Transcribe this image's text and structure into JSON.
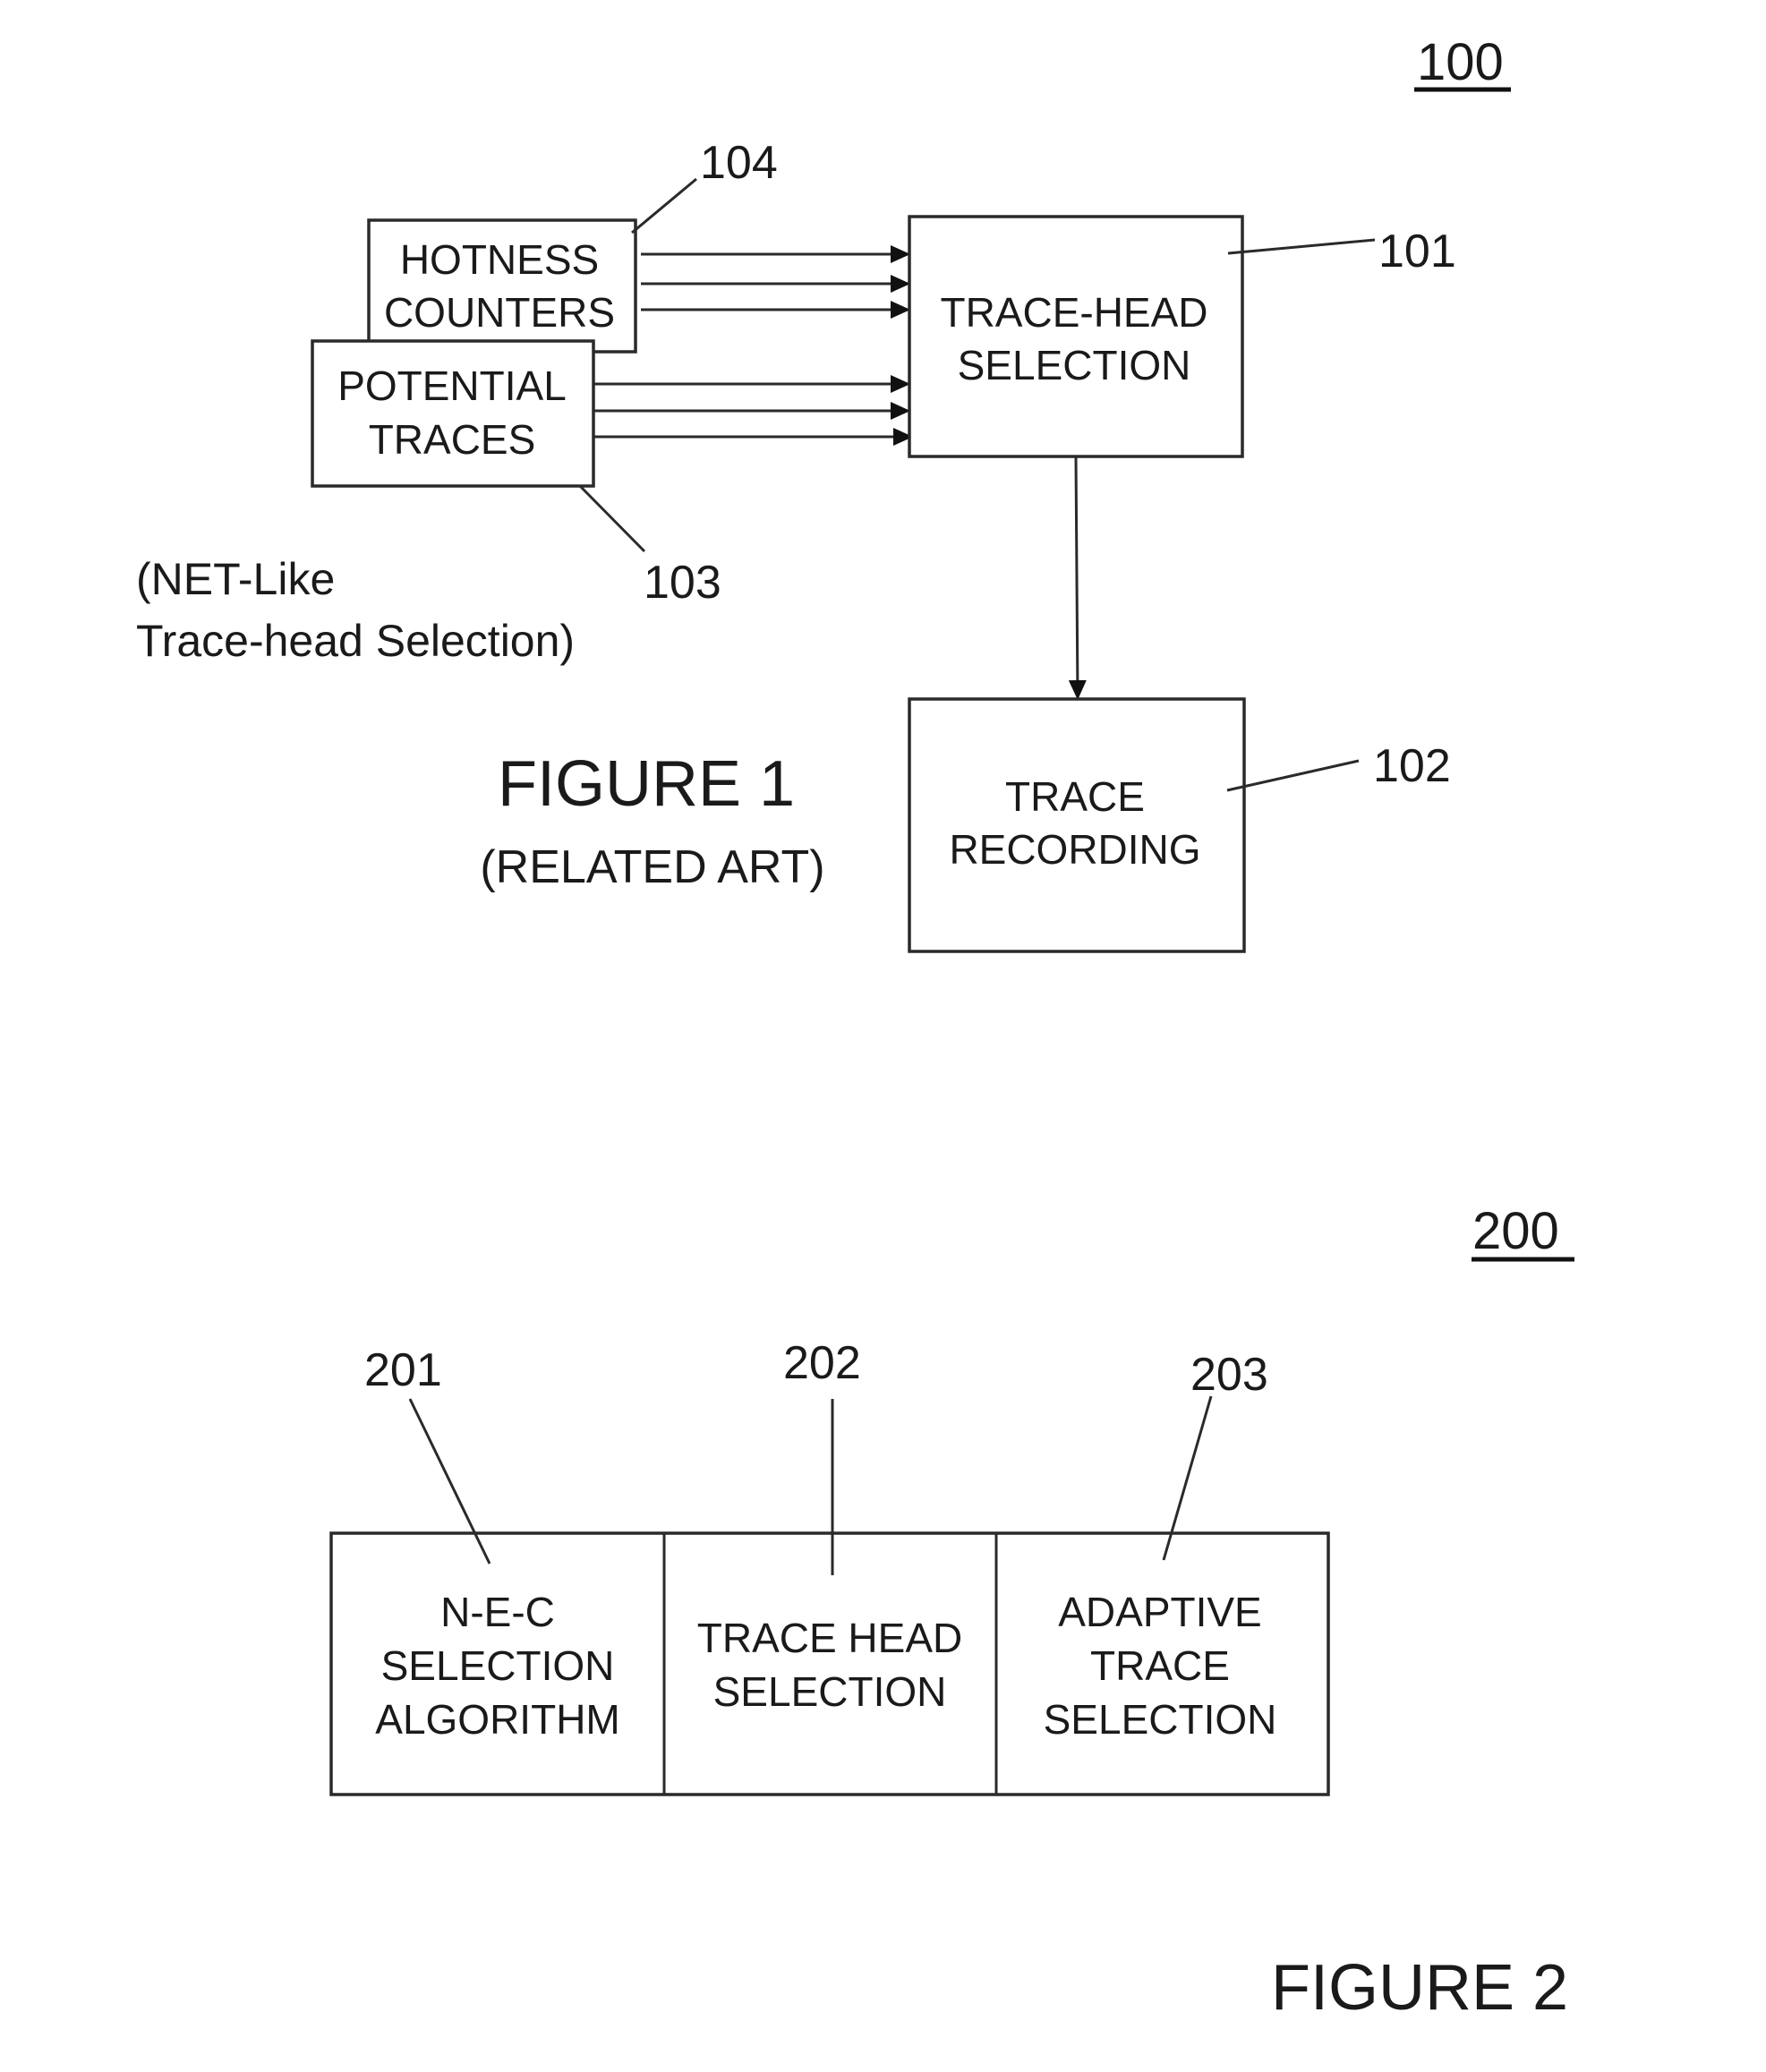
{
  "figure1": {
    "ref_number": "100",
    "caption": "FIGURE 1",
    "subcaption": "(RELATED ART)",
    "note_line1": "(NET-Like",
    "note_line2": "Trace-head Selection)",
    "boxes": {
      "hotness_counters": {
        "ref": "104",
        "lines": [
          "HOTNESS",
          "COUNTERS"
        ]
      },
      "potential_traces": {
        "ref": "103",
        "lines": [
          "POTENTIAL",
          "TRACES"
        ]
      },
      "trace_head_selection": {
        "ref": "101",
        "lines": [
          "TRACE-HEAD",
          "SELECTION"
        ]
      },
      "trace_recording": {
        "ref": "102",
        "lines": [
          "TRACE",
          "RECORDING"
        ]
      }
    },
    "connections": [
      {
        "from": "hotness_counters",
        "to": "trace_head_selection",
        "count": 3
      },
      {
        "from": "potential_traces",
        "to": "trace_head_selection",
        "count": 3
      },
      {
        "from": "trace_head_selection",
        "to": "trace_recording",
        "count": 1
      }
    ]
  },
  "figure2": {
    "ref_number": "200",
    "caption": "FIGURE 2",
    "cells": [
      {
        "ref": "201",
        "lines": [
          "N-E-C",
          "SELECTION",
          "ALGORITHM"
        ]
      },
      {
        "ref": "202",
        "lines": [
          "TRACE HEAD",
          "SELECTION"
        ]
      },
      {
        "ref": "203",
        "lines": [
          "ADAPTIVE",
          "TRACE",
          "SELECTION"
        ]
      }
    ]
  }
}
